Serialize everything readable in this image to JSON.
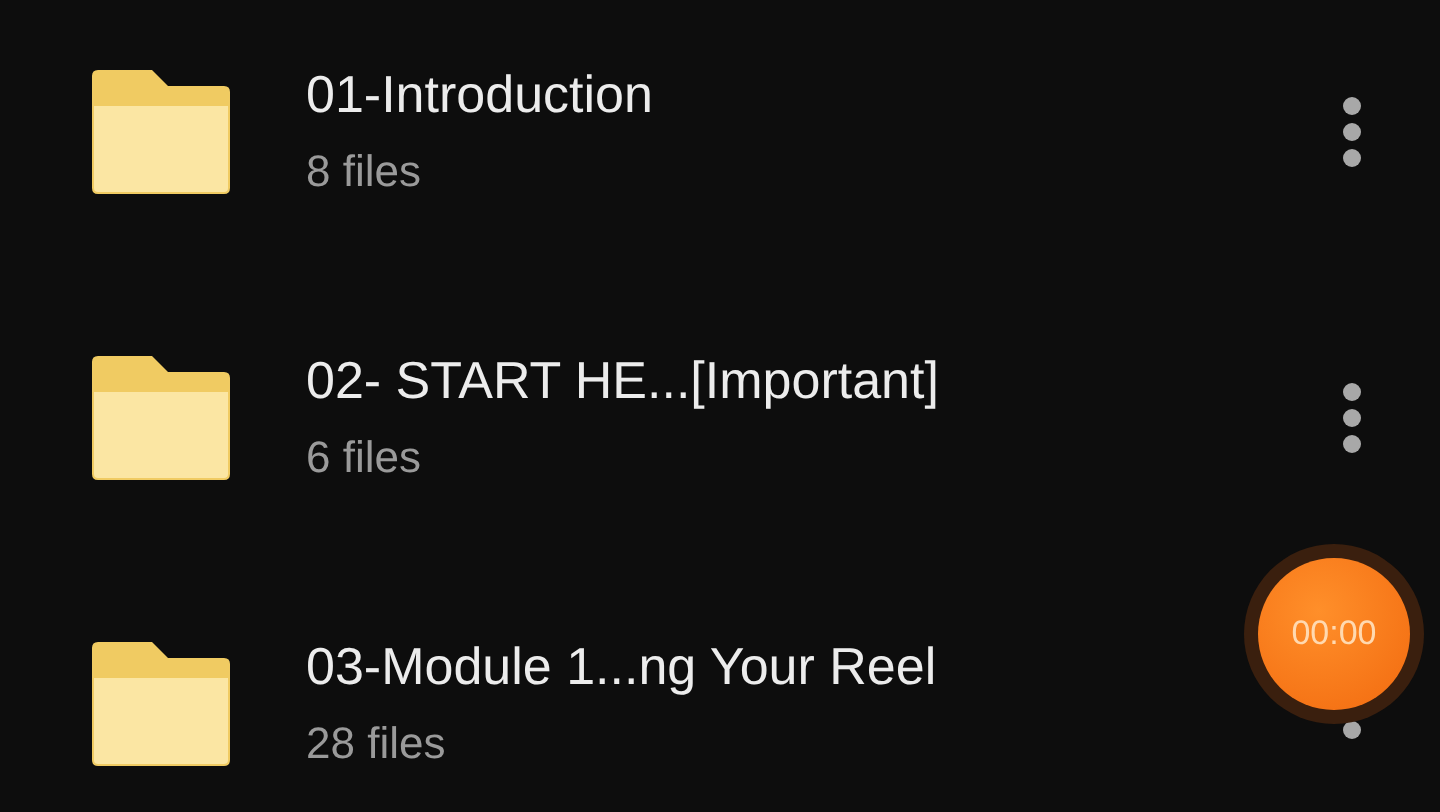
{
  "folders": [
    {
      "name": "01-Introduction",
      "count": "8 files"
    },
    {
      "name": "02- START HE...[Important]",
      "count": "6 files"
    },
    {
      "name": "03-Module 1...ng Your Reel",
      "count": "28 files"
    }
  ],
  "recorder": {
    "time": "00:00"
  }
}
